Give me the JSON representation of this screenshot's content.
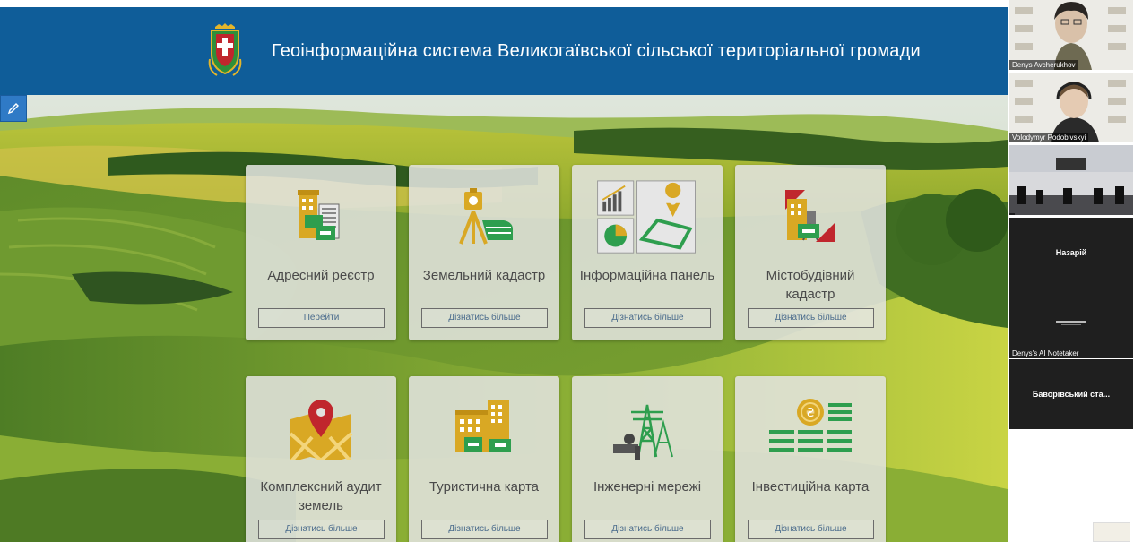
{
  "header": {
    "title": "Геоінформаційна система Великогаївської сільської територіальної громади"
  },
  "cards": [
    {
      "title": "Адресний реєстр",
      "button": "Перейти",
      "icon": "address-register-icon"
    },
    {
      "title": "Земельний кадастр",
      "button": "Дізнатись більше",
      "icon": "land-cadastre-icon"
    },
    {
      "title": "Інформаційна панель",
      "button": "Дізнатись більше",
      "icon": "info-dashboard-icon"
    },
    {
      "title": "Містобудівний кадастр",
      "button": "Дізнатись більше",
      "icon": "urban-cadastre-icon"
    },
    {
      "title": "Комплексний аудит земель",
      "button": "Дізнатись більше",
      "icon": "land-audit-icon"
    },
    {
      "title": "Туристична карта",
      "button": "Дізнатись більше",
      "icon": "tourist-map-icon"
    },
    {
      "title": "Інженерні мережі",
      "button": "Дізнатись більше",
      "icon": "engineering-networks-icon"
    },
    {
      "title": "Інвестиційна карта",
      "button": "Дізнатись більше",
      "icon": "investment-map-icon"
    }
  ],
  "participants": [
    {
      "name": "Denys Avcherukhov"
    },
    {
      "name": "Volodymyr Podobivskyi"
    },
    {
      "name": ""
    },
    {
      "name": "Назарій"
    },
    {
      "name": "Denys's AI Notetaker"
    },
    {
      "name": "Баворівський ста..."
    }
  ],
  "colors": {
    "header_bg": "#0f5d99",
    "icon_gold": "#d9a824",
    "icon_green": "#2e9e4e"
  }
}
